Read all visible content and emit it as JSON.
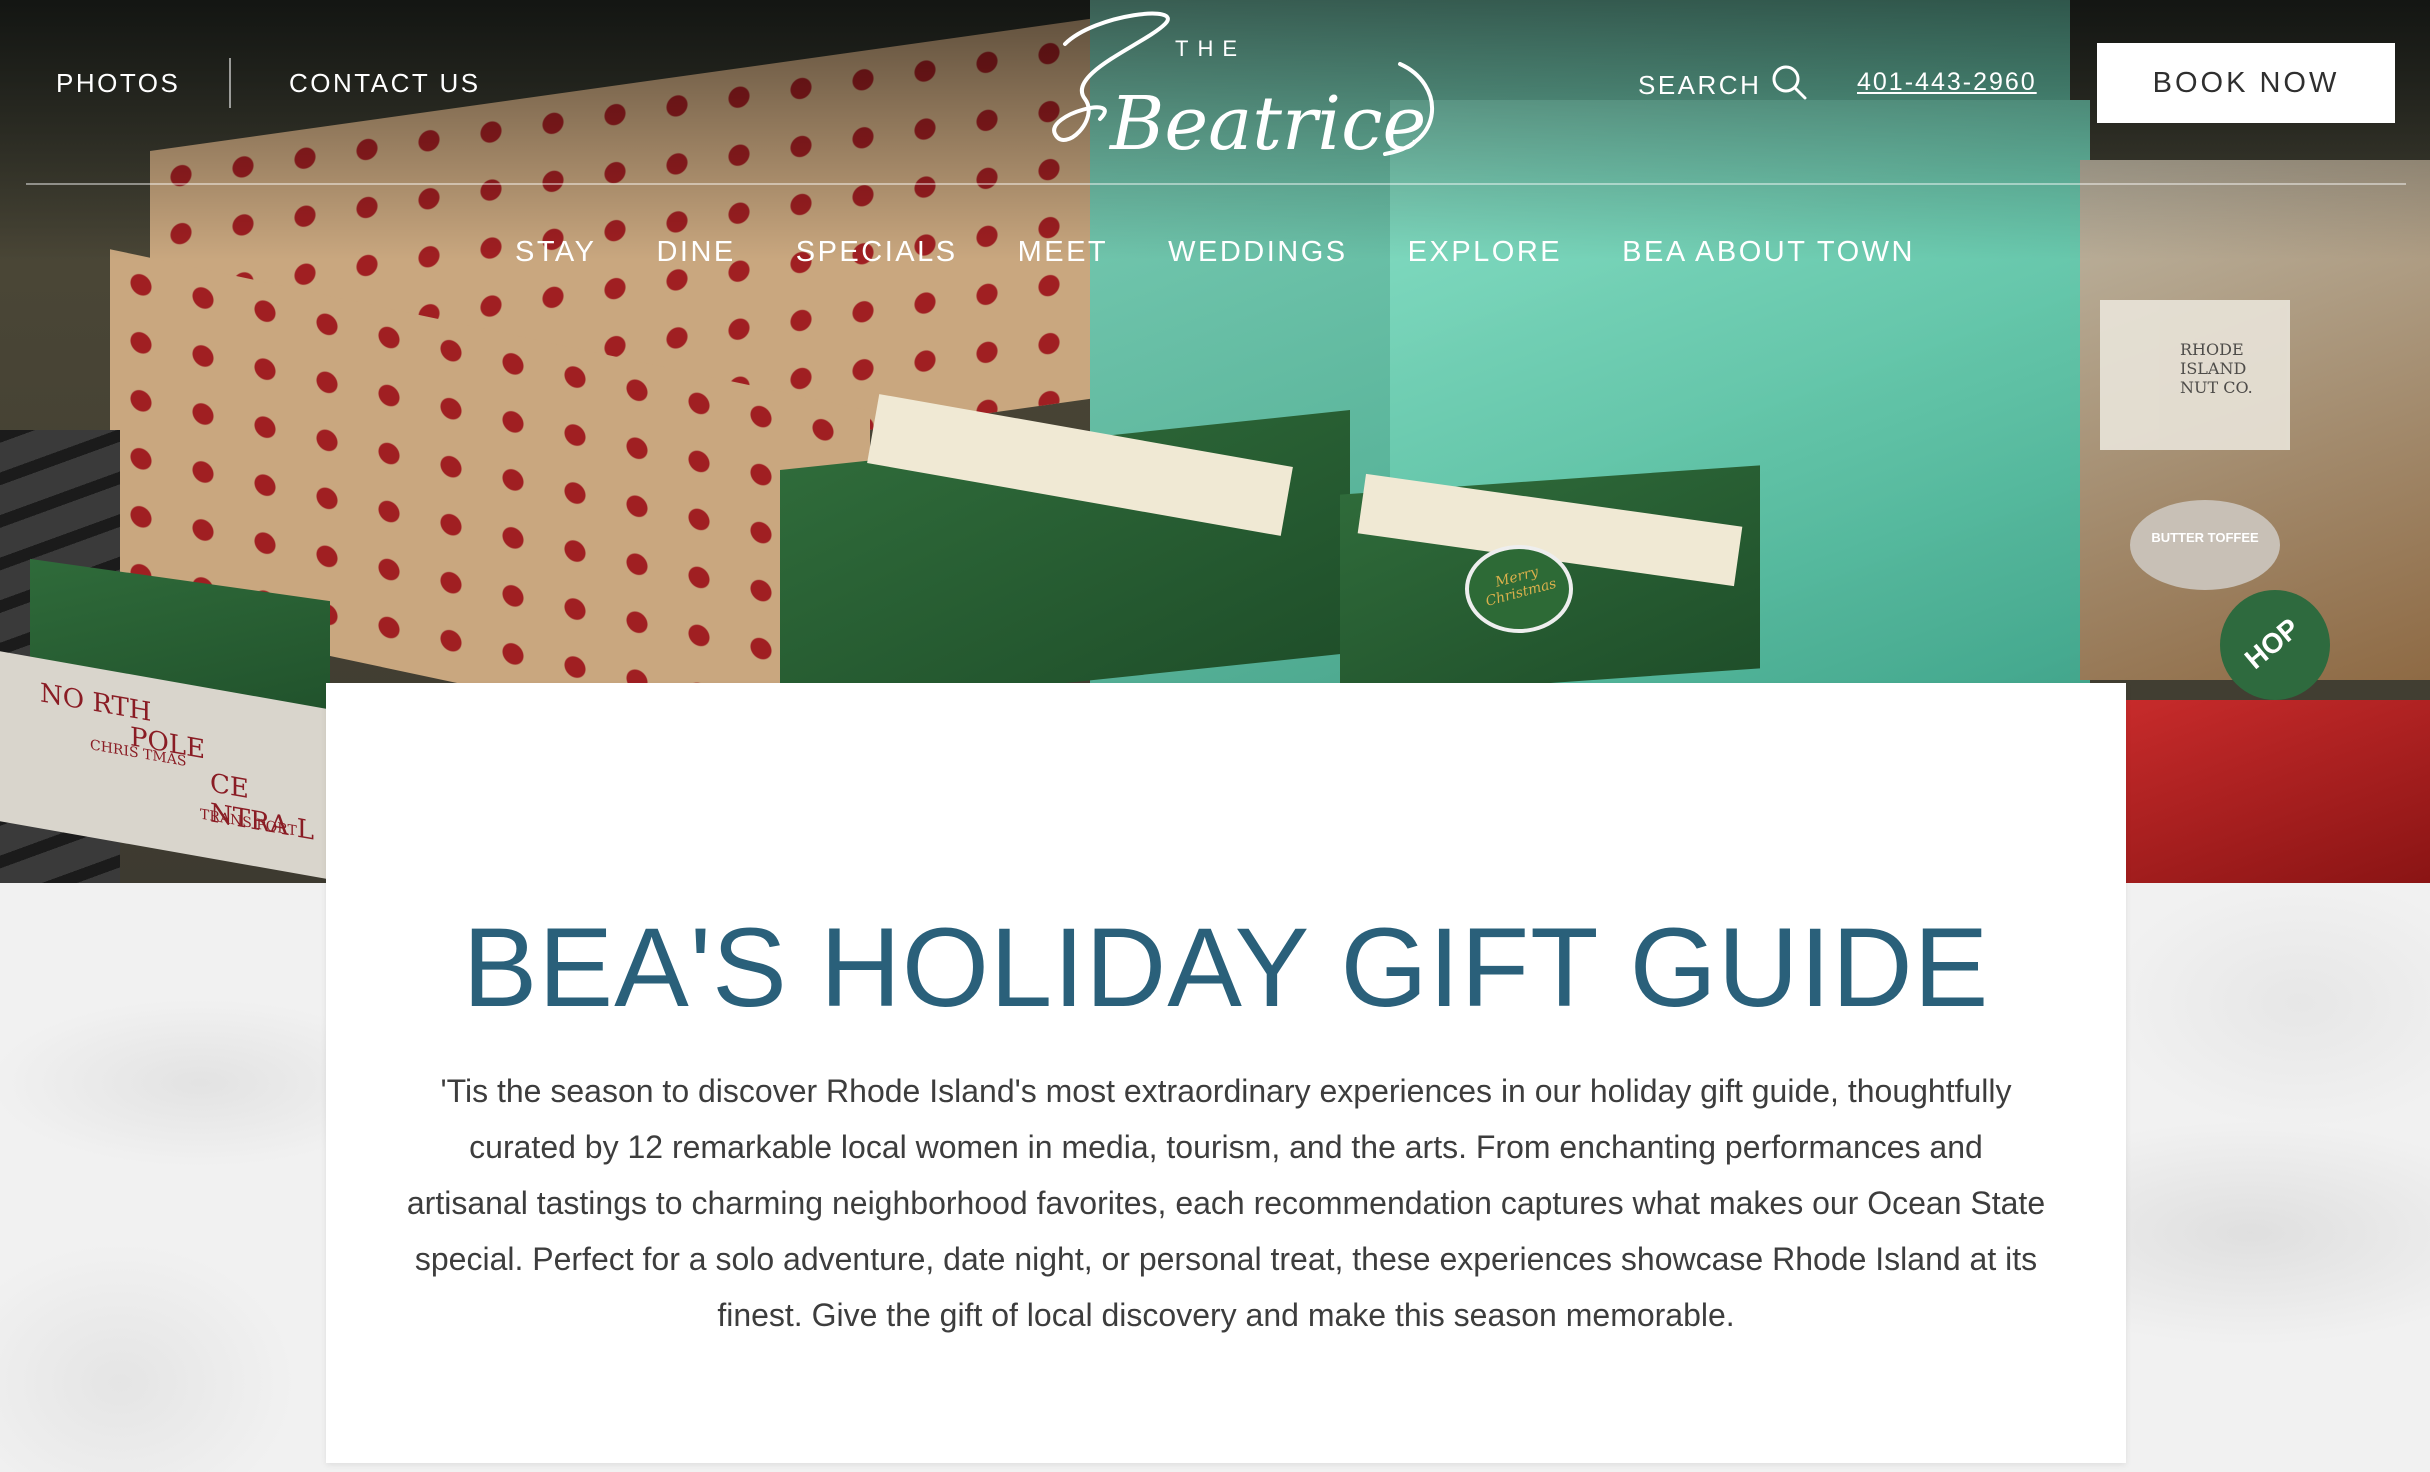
{
  "header": {
    "left_links": [
      {
        "label": "PHOTOS"
      },
      {
        "label": "CONTACT US"
      }
    ],
    "logo": {
      "small": "THE",
      "script": "Beatrice"
    },
    "search_label": "SEARCH",
    "phone": "401-443-2960",
    "book_label": "BOOK NOW"
  },
  "nav": [
    {
      "label": "STAY"
    },
    {
      "label": "DINE"
    },
    {
      "label": "SPECIALS"
    },
    {
      "label": "MEET"
    },
    {
      "label": "WEDDINGS"
    },
    {
      "label": "EXPLORE"
    },
    {
      "label": "BEA ABOUT TOWN"
    }
  ],
  "hero": {
    "railcar_text": [
      "NO RTH",
      "POLE",
      "CE NTRA L",
      "CHRIS TMAS",
      "TRANS PORT"
    ],
    "tag_text": "Merry Christmas",
    "jar_label": "RHODE ISLAND NUT CO.",
    "tin_label": "BUTTER TOFFEE",
    "hop_label": "HOP"
  },
  "content": {
    "title": "BEA'S HOLIDAY GIFT GUIDE",
    "intro": "'Tis the season to discover Rhode Island's most extraordinary experiences in our holiday gift guide, thoughtfully curated by 12 remarkable local women in media, tourism, and the arts. From enchanting performances and artisanal tastings to charming neighborhood favorites, each recommendation captures what makes our Ocean State special. Perfect for a solo adventure, date night, or personal treat, these experiences showcase Rhode Island at its finest. Give the gift of local discovery and make this season memorable."
  },
  "colors": {
    "title": "#2a607a",
    "body_text": "#3d3d3d",
    "button_bg": "#ffffff"
  }
}
